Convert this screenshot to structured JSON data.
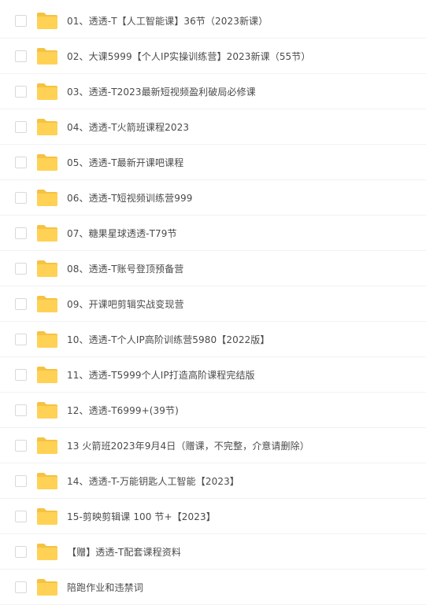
{
  "files": [
    {
      "name": "01、透透-T【人工智能课】36节（2023新课）"
    },
    {
      "name": "02、大课5999【个人IP实操训练营】2023新课（55节）"
    },
    {
      "name": "03、透透-T2023最新短视频盈利破局必修课"
    },
    {
      "name": "04、透透-T火箭班课程2023"
    },
    {
      "name": "05、透透-T最新开课吧课程"
    },
    {
      "name": "06、透透-T短视频训练营999"
    },
    {
      "name": "07、糖果星球透透-T79节"
    },
    {
      "name": "08、透透-T账号登顶预备营"
    },
    {
      "name": "09、开课吧剪辑实战变现营"
    },
    {
      "name": "10、透透-T个人IP高阶训练营5980【2022版】"
    },
    {
      "name": "11、透透-T5999个人IP打造高阶课程完结版"
    },
    {
      "name": "12、透透-T6999+(39节)"
    },
    {
      "name": "13 火箭班2023年9月4日（赠课，不完整，介意请删除）"
    },
    {
      "name": "14、透透-T-万能钥匙人工智能【2023】"
    },
    {
      "name": "15-剪映剪辑课 100 节+【2023】"
    },
    {
      "name": "【赠】透透-T配套课程资料"
    },
    {
      "name": "陪跑作业和违禁词"
    }
  ],
  "colors": {
    "folder": "#ffd155",
    "folder_tab": "#f5c242",
    "text": "#4a4a4a",
    "divider": "#f2f2f2",
    "checkbox_border": "#d9d9d9"
  },
  "icons": {
    "checkbox": "checkbox-icon",
    "folder": "folder-icon"
  }
}
